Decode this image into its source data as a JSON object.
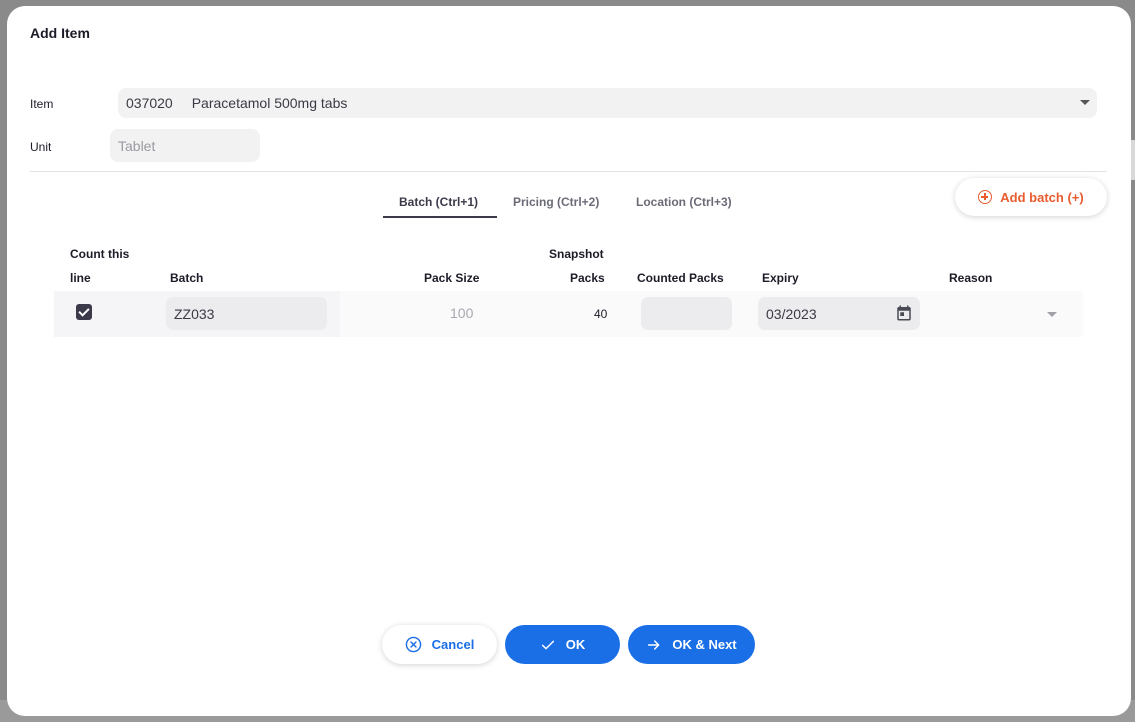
{
  "dialog": {
    "title": "Add Item"
  },
  "item_field": {
    "label": "Item",
    "code": "037020",
    "name": "Paracetamol 500mg tabs"
  },
  "unit_field": {
    "label": "Unit",
    "placeholder": "Tablet"
  },
  "tabs": [
    {
      "label": "Batch (Ctrl+1)",
      "active": true
    },
    {
      "label": "Pricing (Ctrl+2)",
      "active": false
    },
    {
      "label": "Location (Ctrl+3)",
      "active": false
    }
  ],
  "add_batch_label": "Add batch (+)",
  "table": {
    "headers": {
      "count_line_1": "Count this",
      "count_line_2": "line",
      "batch": "Batch",
      "pack_size": "Pack Size",
      "snapshot_line_1": "Snapshot",
      "snapshot_line_2": "Packs",
      "counted_packs": "Counted Packs",
      "expiry": "Expiry",
      "reason": "Reason"
    },
    "rows": [
      {
        "checked": true,
        "batch": "ZZ033",
        "pack_size": "100",
        "snapshot_packs": "40",
        "counted_packs": "",
        "expiry": "03/2023",
        "reason": ""
      }
    ]
  },
  "buttons": {
    "cancel": "Cancel",
    "ok": "OK",
    "ok_next": "OK & Next"
  },
  "colors": {
    "primary": "#1a6fe6",
    "accent": "#e95c30"
  },
  "icons": [
    "add-circle-icon",
    "checkbox-checked-icon",
    "calendar-icon",
    "chevron-down-icon",
    "cancel-circle-icon",
    "check-icon",
    "arrow-right-icon"
  ]
}
